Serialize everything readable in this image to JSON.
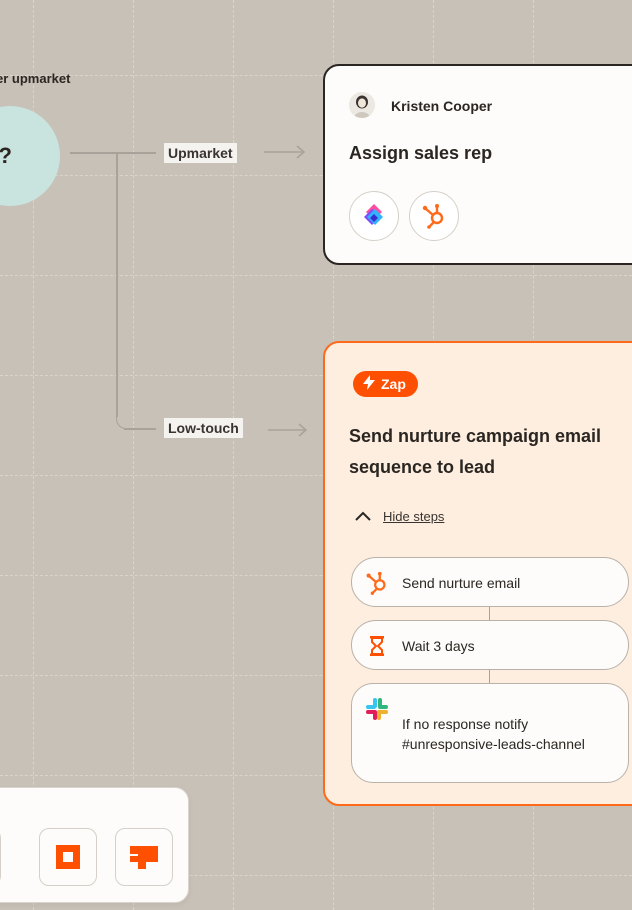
{
  "decision": {
    "question_fragment": "er upmarket",
    "symbol": "?"
  },
  "branches": {
    "upper": "Upmarket",
    "lower": "Low-touch"
  },
  "assign_card": {
    "person": "Kristen Cooper",
    "title": "Assign sales rep",
    "apps": [
      "multicolor-diamond-app-icon",
      "hubspot-icon"
    ]
  },
  "zap_card": {
    "badge": "Zap",
    "title_line1": "Send nurture campaign email",
    "title_line2": "sequence to lead",
    "toggle_label": "Hide steps",
    "steps": [
      {
        "label": "Send nurture email",
        "icon": "hubspot-icon"
      },
      {
        "label": "Wait 3 days",
        "icon": "hourglass-icon"
      },
      {
        "label_line1": "If no response notify",
        "label_line2": "#unresponsive-leads-channel",
        "icon": "slack-icon"
      }
    ]
  },
  "tray": {
    "tiles": [
      "orange-partial-icon",
      "orange-square-icon",
      "orange-chat-icon"
    ]
  },
  "colors": {
    "accent": "#ff4f00",
    "zap_border": "#ff6a1a",
    "zap_bg": "#fdeee0",
    "decision_bg": "#c9e3df",
    "canvas_bg": "#f5f3ef"
  }
}
